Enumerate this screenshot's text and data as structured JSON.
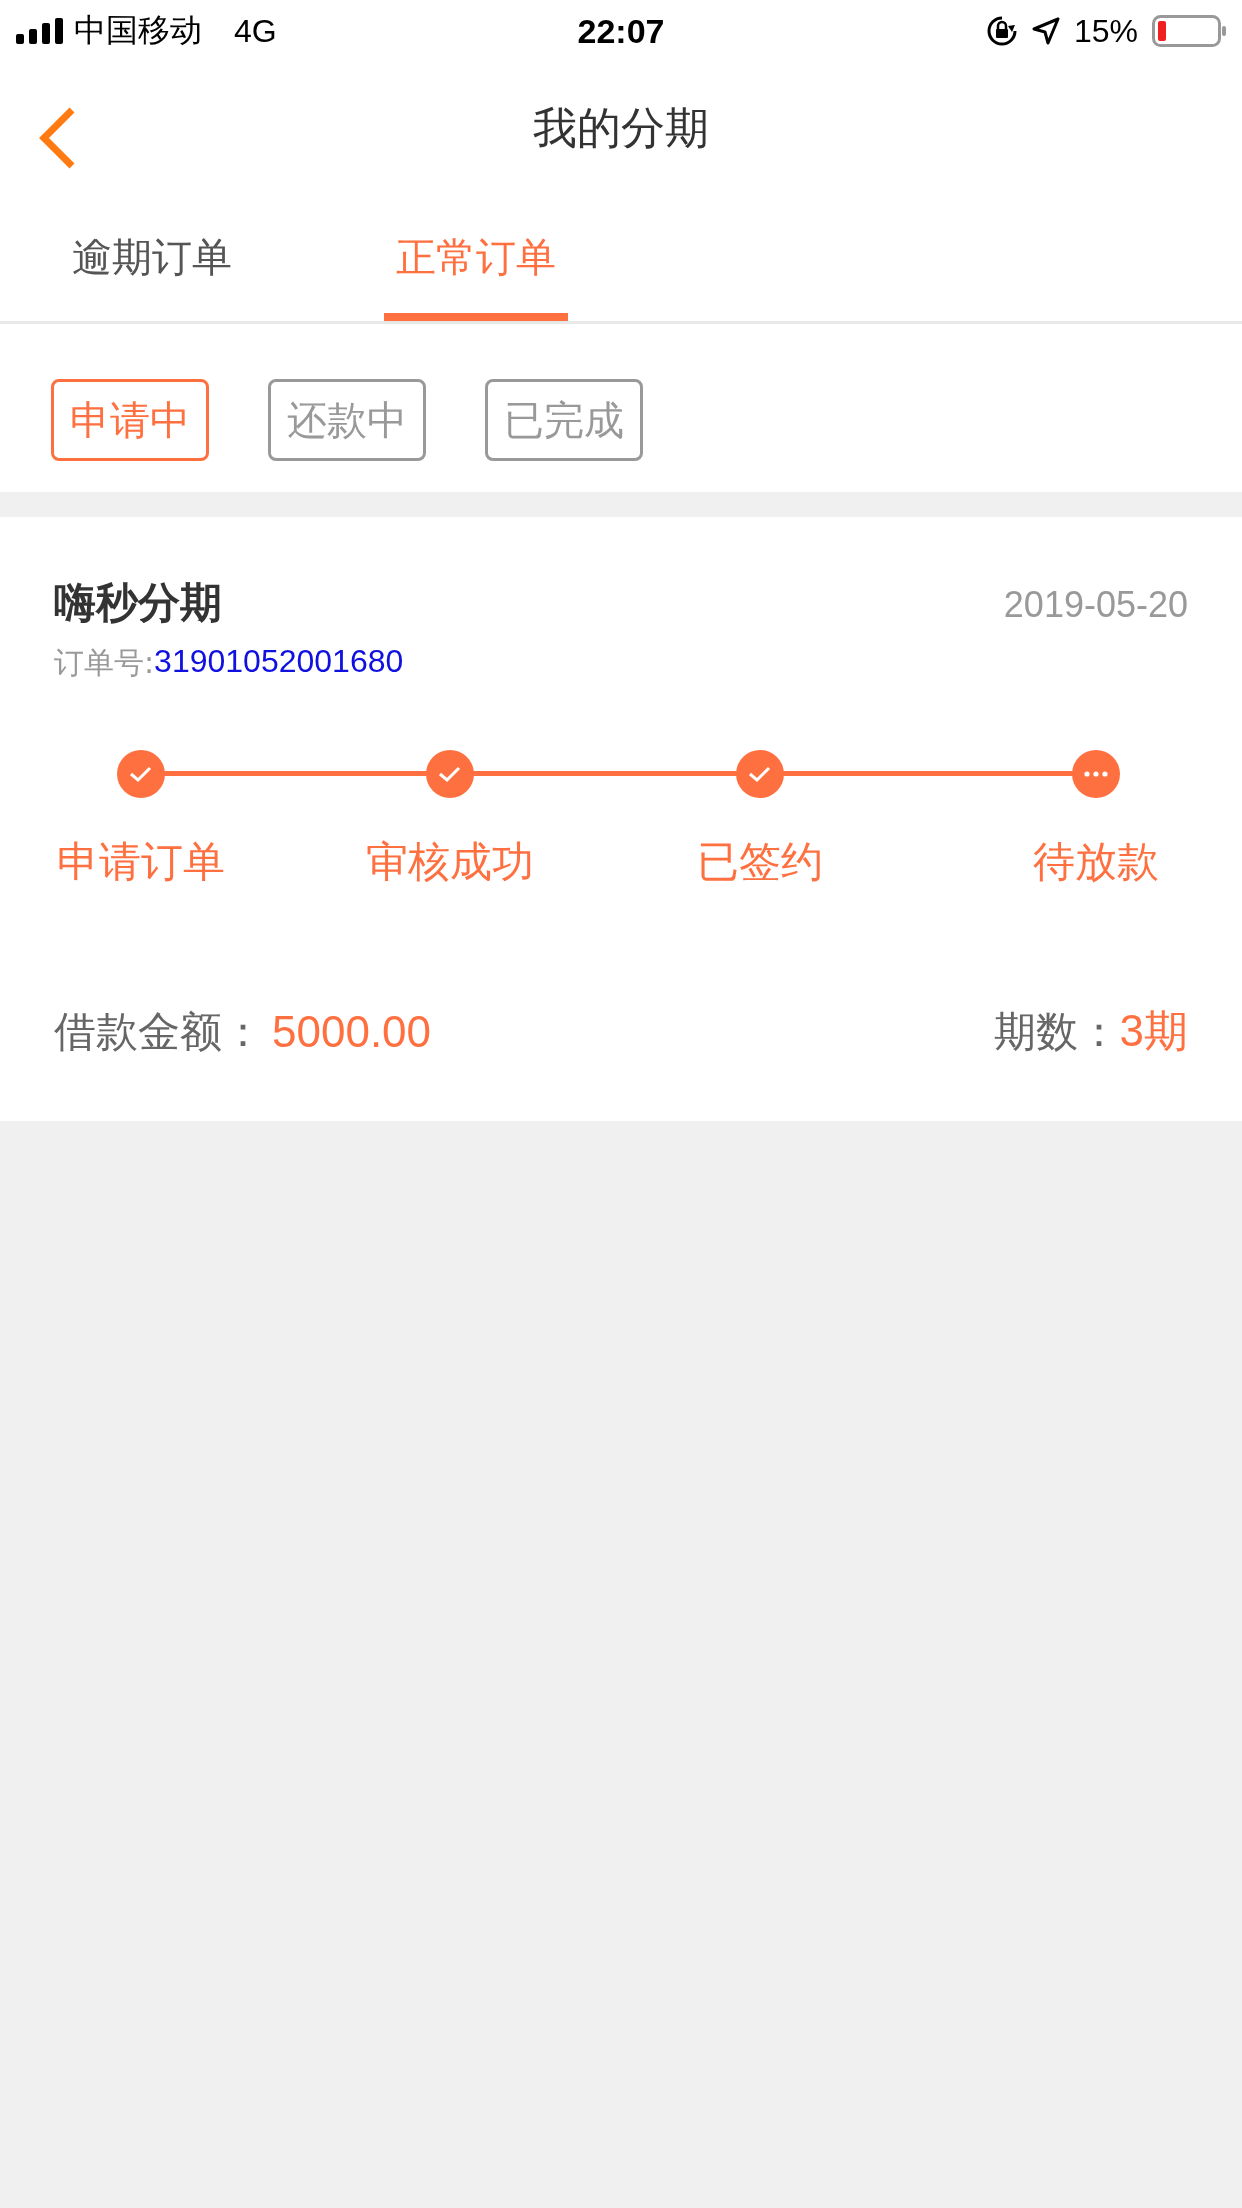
{
  "status_bar": {
    "carrier": "中国移动",
    "network": "4G",
    "time": "22:07",
    "battery": "15%"
  },
  "nav": {
    "title": "我的分期"
  },
  "tabs": [
    {
      "label": "逾期订单",
      "selected": false
    },
    {
      "label": "正常订单",
      "selected": true
    }
  ],
  "filters": [
    {
      "label": "申请中",
      "selected": true
    },
    {
      "label": "还款中",
      "selected": false
    },
    {
      "label": "已完成",
      "selected": false
    }
  ],
  "order": {
    "name": "嗨秒分期",
    "date": "2019-05-20",
    "order_no_label": "订单号:",
    "order_no": "31901052001680",
    "steps": [
      {
        "label": "申请订单",
        "kind": "done"
      },
      {
        "label": "审核成功",
        "kind": "done"
      },
      {
        "label": "已签约",
        "kind": "done"
      },
      {
        "label": "待放款",
        "kind": "pending"
      }
    ],
    "amount_label": "借款金额：",
    "amount": "5000.00",
    "periods_label": "期数：",
    "periods": "3期"
  }
}
